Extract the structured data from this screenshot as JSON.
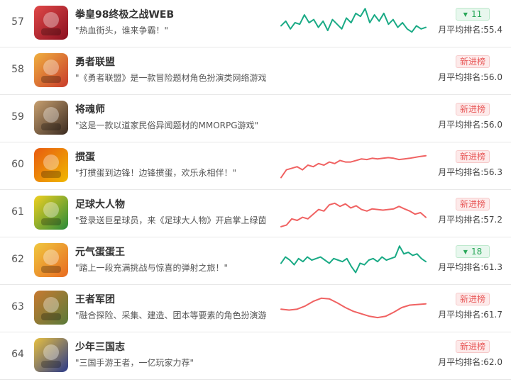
{
  "avg_label": "月平均排名:",
  "colors": {
    "up": "#1aaa85",
    "down": "#f06262",
    "new_text": "#e85a5a",
    "up_text": "#2aa85a"
  },
  "rows": [
    {
      "rank": "57",
      "name": "拳皇98终极之战WEB",
      "desc": "\"热血街头，谁来争霸！\"",
      "badge_type": "up",
      "badge": "11",
      "avg": "55.4",
      "trend": "green",
      "icon": [
        "#8a1020",
        "#e04848"
      ],
      "points": [
        0.4,
        0.55,
        0.3,
        0.5,
        0.45,
        0.75,
        0.5,
        0.6,
        0.35,
        0.55,
        0.25,
        0.6,
        0.45,
        0.3,
        0.65,
        0.5,
        0.8,
        0.7,
        0.95,
        0.5,
        0.75,
        0.55,
        0.8,
        0.45,
        0.6,
        0.35,
        0.5,
        0.3,
        0.2,
        0.4,
        0.3,
        0.35
      ]
    },
    {
      "rank": "58",
      "name": "勇者联盟",
      "desc": "\"《勇者联盟》是一款冒险题材角色扮演类网络游戏\"",
      "badge_type": "new",
      "badge": "新进榜",
      "avg": "56.0",
      "trend": "",
      "icon": [
        "#c83a2a",
        "#f0b040"
      ],
      "points": []
    },
    {
      "rank": "59",
      "name": "将魂师",
      "desc": "\"这是一款以道家民俗异闻题材的MMORPG游戏\"",
      "badge_type": "new",
      "badge": "新进榜",
      "avg": "56.0",
      "trend": "",
      "icon": [
        "#3a2a20",
        "#c8a070"
      ],
      "points": []
    },
    {
      "rank": "60",
      "name": "掼蛋",
      "desc": "\"打掼蛋到边锋！边锋掼蛋，欢乐永相伴！\"",
      "badge_type": "new",
      "badge": "新进榜",
      "avg": "56.3",
      "trend": "red",
      "icon": [
        "#f0b800",
        "#e85a10"
      ],
      "points": [
        0.1,
        0.35,
        0.4,
        0.45,
        0.35,
        0.5,
        0.45,
        0.55,
        0.5,
        0.6,
        0.55,
        0.65,
        0.6,
        0.6,
        0.65,
        0.7,
        0.68,
        0.72,
        0.7,
        0.72,
        0.74,
        0.72,
        0.68,
        0.7,
        0.72,
        0.75,
        0.78,
        0.8
      ]
    },
    {
      "rank": "61",
      "name": "足球大人物",
      "desc": "\"登录送巨星球员，来《足球大人物》开启掌上绿茵之旅\"",
      "badge_type": "new",
      "badge": "新进榜",
      "avg": "57.2",
      "trend": "red",
      "icon": [
        "#2a8a3a",
        "#f0d020"
      ],
      "points": [
        0.05,
        0.1,
        0.3,
        0.25,
        0.35,
        0.3,
        0.45,
        0.6,
        0.55,
        0.75,
        0.8,
        0.7,
        0.78,
        0.65,
        0.72,
        0.6,
        0.55,
        0.62,
        0.6,
        0.58,
        0.6,
        0.62,
        0.7,
        0.62,
        0.55,
        0.45,
        0.5,
        0.35
      ]
    },
    {
      "rank": "62",
      "name": "元气蛋蛋王",
      "desc": "\"踏上一段充满挑战与惊喜的弹射之旅！\"",
      "badge_type": "up",
      "badge": "18",
      "avg": "61.3",
      "trend": "green",
      "icon": [
        "#e86a20",
        "#f0c840"
      ],
      "points": [
        0.4,
        0.6,
        0.5,
        0.35,
        0.55,
        0.45,
        0.6,
        0.5,
        0.55,
        0.6,
        0.5,
        0.4,
        0.55,
        0.5,
        0.45,
        0.55,
        0.3,
        0.1,
        0.4,
        0.35,
        0.5,
        0.55,
        0.45,
        0.6,
        0.5,
        0.55,
        0.6,
        0.95,
        0.7,
        0.75,
        0.65,
        0.7,
        0.55,
        0.45
      ]
    },
    {
      "rank": "63",
      "name": "王者军团",
      "desc": "\"融合探险、采集、建造、团本等要素的角色扮演游戏\"",
      "badge_type": "new",
      "badge": "新进榜",
      "avg": "61.7",
      "trend": "red",
      "icon": [
        "#5a7a3a",
        "#c87a30"
      ],
      "points": [
        0.45,
        0.42,
        0.45,
        0.55,
        0.7,
        0.8,
        0.78,
        0.65,
        0.5,
        0.38,
        0.3,
        0.22,
        0.18,
        0.22,
        0.35,
        0.5,
        0.58,
        0.6,
        0.62
      ]
    },
    {
      "rank": "64",
      "name": "少年三国志",
      "desc": "\"三国手游王者，一亿玩家力荐\"",
      "badge_type": "new",
      "badge": "新进榜",
      "avg": "62.0",
      "trend": "",
      "icon": [
        "#2a3a8a",
        "#e8c040"
      ],
      "points": []
    }
  ]
}
